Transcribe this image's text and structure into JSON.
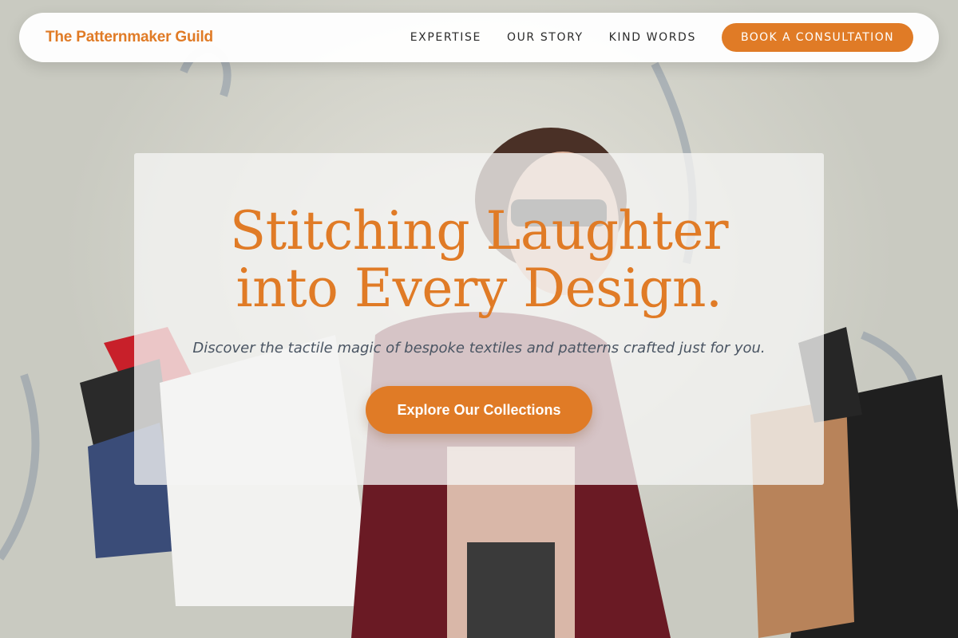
{
  "navbar": {
    "brand": "The Patternmaker Guild",
    "links": [
      {
        "label": "EXPERTISE"
      },
      {
        "label": "OUR STORY"
      },
      {
        "label": "KIND WORDS"
      }
    ],
    "cta_label": "BOOK A CONSULTATION"
  },
  "hero": {
    "title_line1": "Stitching Laughter",
    "title_line2": "into Every Design.",
    "subtitle": "Discover the tactile magic of bespoke textiles and patterns crafted just for you.",
    "button_label": "Explore Our Collections"
  },
  "colors": {
    "accent": "#e07b26",
    "subtitle_text": "#4a5563",
    "nav_text": "#2b2b2b"
  }
}
